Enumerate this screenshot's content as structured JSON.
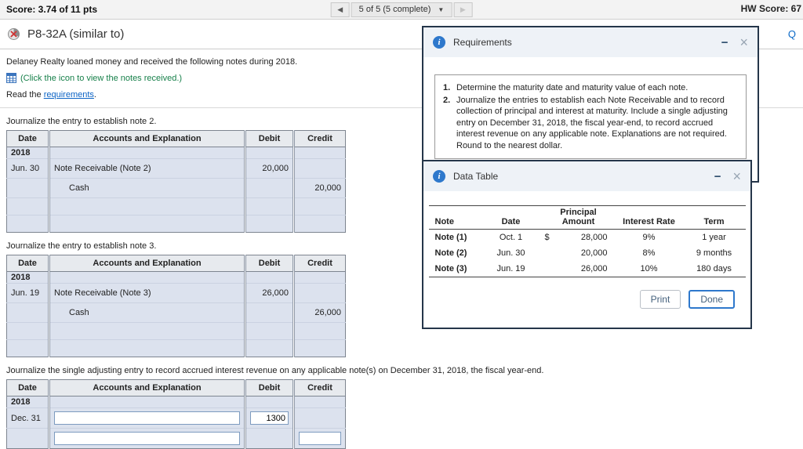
{
  "icons": {
    "prev": "◀",
    "next": "▶",
    "caret": "▼",
    "info": "i",
    "minimize": "−",
    "close": "×",
    "similar_x": "×"
  },
  "topbar": {
    "score": "Score: 3.74 of 11 pts",
    "question_nav": "5 of 5 (5 complete)",
    "hw_score": "HW Score: 67"
  },
  "titlebar": {
    "title": "P8-32A (similar to)",
    "help": "Q"
  },
  "intro": {
    "line1": "Delaney Realty loaned money and received the following notes during 2018.",
    "icon_link": "(Click the icon to view the notes received.)",
    "read_prefix": "Read the ",
    "read_link": "requirements",
    "read_suffix": "."
  },
  "journal_headers": {
    "date": "Date",
    "accounts": "Accounts and Explanation",
    "debit": "Debit",
    "credit": "Credit"
  },
  "journal1": {
    "label": "Journalize the entry to establish note 2.",
    "year": "2018",
    "rows": [
      {
        "date": "Jun. 30",
        "account": "Note Receivable (Note 2)",
        "debit": "20,000",
        "credit": ""
      },
      {
        "date": "",
        "account": "Cash",
        "debit": "",
        "credit": "20,000"
      }
    ]
  },
  "journal2": {
    "label": "Journalize the entry to establish note 3.",
    "year": "2018",
    "rows": [
      {
        "date": "Jun. 19",
        "account": "Note Receivable (Note 3)",
        "debit": "26,000",
        "credit": ""
      },
      {
        "date": "",
        "account": "Cash",
        "debit": "",
        "credit": "26,000"
      }
    ]
  },
  "journal3": {
    "label": "Journalize the single adjusting entry to record accrued interest revenue on any applicable note(s) on December 31, 2018, the fiscal year-end.",
    "year": "2018",
    "date": "Dec. 31",
    "account_input": "",
    "debit_input": "1300",
    "second_account_input": "",
    "credit_input": ""
  },
  "dialogs": {
    "requirements": {
      "title": "Requirements",
      "items": [
        {
          "num": "1.",
          "text": "Determine the maturity date and maturity value of each note."
        },
        {
          "num": "2.",
          "text": "Journalize the entries to establish each Note Receivable and to record collection of principal and interest at maturity. Include a single adjusting entry on December 31, 2018, the fiscal year-end, to record accrued interest revenue on any applicable note. Explanations are not required. Round to the nearest dollar."
        }
      ]
    },
    "data_table": {
      "title": "Data Table",
      "headers": {
        "note": "Note",
        "date": "Date",
        "principal_line1": "Principal",
        "principal_line2": "Amount",
        "rate": "Interest Rate",
        "term": "Term"
      },
      "rows": [
        {
          "note": "Note (1)",
          "date": "Oct. 1",
          "currency": "$",
          "amount": "28,000",
          "rate": "9%",
          "term": "1 year"
        },
        {
          "note": "Note (2)",
          "date": "Jun. 30",
          "currency": "",
          "amount": "20,000",
          "rate": "8%",
          "term": "9 months"
        },
        {
          "note": "Note (3)",
          "date": "Jun. 19",
          "currency": "",
          "amount": "26,000",
          "rate": "10%",
          "term": "180 days"
        }
      ],
      "print_label": "Print",
      "done_label": "Done"
    }
  }
}
